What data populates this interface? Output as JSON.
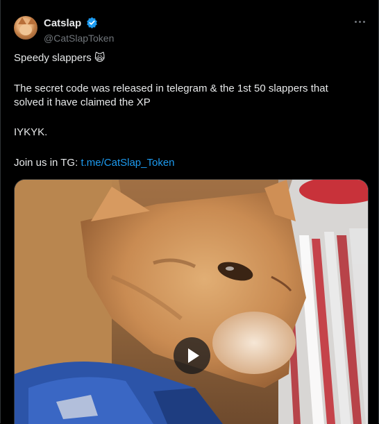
{
  "account": {
    "display_name": "Catslap",
    "handle": "@CatSlapToken",
    "verified_badge": "blue-check-icon"
  },
  "post": {
    "line1_text": "Speedy slappers ",
    "line1_emoji": "🙀",
    "line2": "The secret code was released in telegram & the 1st 50 slappers that solved it have claimed the XP",
    "line3": "IYKYK.",
    "line4_prefix": "Join us in TG: ",
    "link": "t.me/CatSlap_Token"
  },
  "media": {
    "type": "video",
    "play_icon": "play-icon"
  },
  "colors": {
    "background": "#000000",
    "text": "#e7e9ea",
    "muted": "#71767b",
    "link": "#1d9bf0",
    "verified": "#1d9bf0"
  }
}
